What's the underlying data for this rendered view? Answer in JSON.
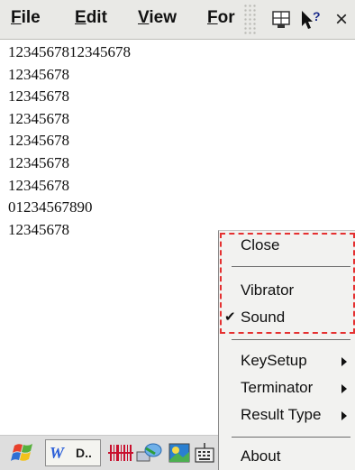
{
  "menubar": {
    "items": [
      {
        "label": "File",
        "key": "F",
        "rest": "ile"
      },
      {
        "label": "Edit",
        "key": "E",
        "rest": "dit"
      },
      {
        "label": "View",
        "key": "V",
        "rest": "iew"
      },
      {
        "label": "For",
        "key": "F",
        "rest": "or"
      }
    ],
    "close_glyph": "×"
  },
  "content": {
    "lines": [
      "1234567812345678",
      "12345678",
      "12345678",
      "12345678",
      "12345678",
      "12345678",
      "12345678",
      "01234567890",
      "12345678"
    ]
  },
  "taskbar": {
    "app_label": "D.."
  },
  "popup_menu": {
    "items": [
      {
        "label": "Close"
      },
      {
        "label": "Vibrator"
      },
      {
        "label": "Sound",
        "checked": true
      },
      {
        "label": "KeySetup",
        "submenu": true
      },
      {
        "label": "Terminator",
        "submenu": true
      },
      {
        "label": "Result Type",
        "submenu": true
      },
      {
        "label": "About"
      }
    ],
    "check_glyph": "✔",
    "highlight_color": "#e53030"
  }
}
